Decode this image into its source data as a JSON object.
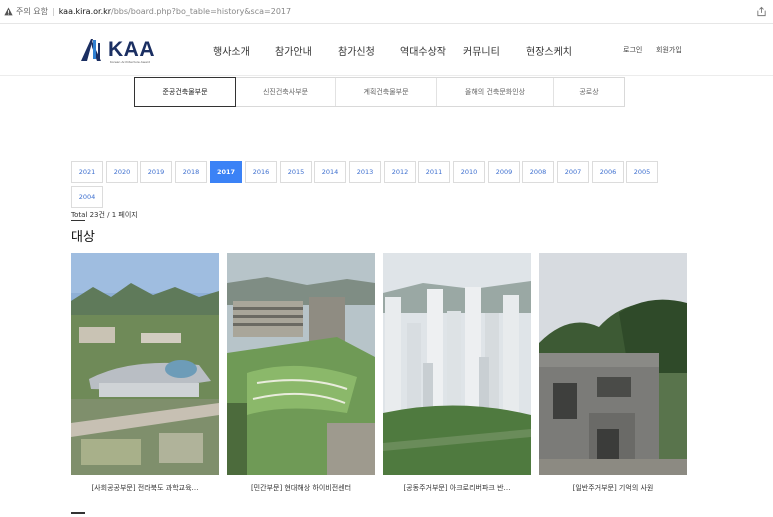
{
  "browser": {
    "warning_label": "주의 요함",
    "url_host": "kaa.kira.or.kr",
    "url_path": "/bbs/board.php?bo_table=history&sca=2017"
  },
  "header": {
    "logo_text": "KAA",
    "logo_subtitle": "Korean Architecture Award",
    "nav": [
      "행사소개",
      "참가안내",
      "참가신청",
      "역대수상작",
      "커뮤니티",
      "현장스케치"
    ],
    "login": "로그인",
    "signup": "회원가입"
  },
  "categories": {
    "items": [
      "준공건축물부문",
      "신진건축사부문",
      "계획건축물부문",
      "올해의 건축문화인상",
      "공로상"
    ],
    "active": "준공건축물부문"
  },
  "years": {
    "items": [
      "2021",
      "2020",
      "2019",
      "2018",
      "2017",
      "2016",
      "2015",
      "2014",
      "2013",
      "2012",
      "2011",
      "2010",
      "2009",
      "2008",
      "2007",
      "2006",
      "2005",
      "2004"
    ],
    "active": "2017"
  },
  "total_text": "Total 23건 / 1 페이지",
  "section_title": "대상",
  "cards": [
    {
      "caption": "[사회공공부문] 전라북도 과학교육…"
    },
    {
      "caption": "[민간부문] 현대해상 하이비전센터"
    },
    {
      "caption": "[공동주거부문] 아크로리버파크 반…"
    },
    {
      "caption": "[일반주거부문] 기억의 사원"
    }
  ],
  "colors": {
    "accent": "#3b82f6",
    "logo_navy": "#1b2f62",
    "year_text": "#3d6fcf"
  }
}
